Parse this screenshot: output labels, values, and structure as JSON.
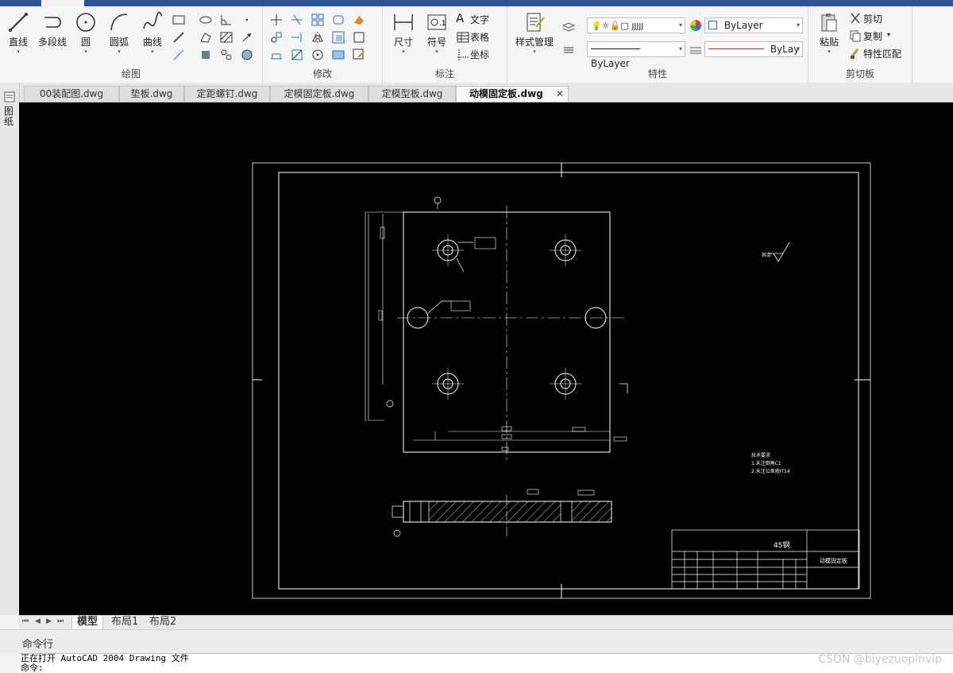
{
  "ribbon": {
    "draw": {
      "title": "绘图",
      "line": "直线",
      "polyline": "多段线",
      "circle": "圆",
      "arc": "圆弧",
      "curve": "曲线"
    },
    "modify": {
      "title": "修改"
    },
    "annotate": {
      "title": "标注",
      "dimension": "尺寸",
      "symbol": "符号",
      "text": "文字",
      "table": "表格",
      "coord": "坐标"
    },
    "properties": {
      "title": "特性",
      "style_manager": "样式管理",
      "layer_value": "JJJJJ",
      "color_value": "ByLayer",
      "linetype_value": "ByLayer",
      "lineweight_value": "ByLay"
    },
    "clipboard": {
      "title": "剪切板",
      "paste": "粘贴",
      "cut": "剪切",
      "copy": "复制",
      "match": "特性匹配"
    }
  },
  "doc_tabs": [
    "00装配图.dwg",
    "垫板.dwg",
    "定距螺钉.dwg",
    "定模固定板.dwg",
    "定模型板.dwg",
    "动模固定板.dwg"
  ],
  "active_tab": "动模固定板.dwg",
  "left_strip_label": "图纸",
  "drawing": {
    "material": "45钢",
    "part_name": "动模固定板",
    "roughness_label": "其余",
    "tech_req_title": "技术要求",
    "tech_req_1": "1.未注倒角C1",
    "tech_req_2": "2.未注公差按IT14"
  },
  "layout_tabs": [
    "模型",
    "布局1",
    "布局2"
  ],
  "active_layout": "模型",
  "command": {
    "header": "命令行",
    "line1": "正在打开 AutoCAD 2004 Drawing 文件",
    "line2": "命令:"
  },
  "watermark": "CSDN @biyezuopinvip",
  "colors": {
    "title_bar": "#2b579a",
    "canvas": "#000000",
    "drawing": "#ffffff",
    "linetype_red": "#d22020"
  }
}
